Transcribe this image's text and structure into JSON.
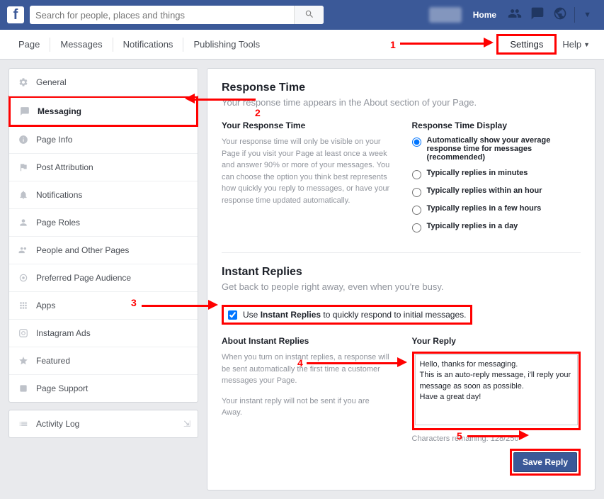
{
  "topbar": {
    "search_placeholder": "Search for people, places and things",
    "home": "Home"
  },
  "tabs": {
    "page": "Page",
    "messages": "Messages",
    "notifications": "Notifications",
    "publishing": "Publishing Tools",
    "settings": "Settings",
    "help": "Help"
  },
  "sidebar": {
    "general": "General",
    "messaging": "Messaging",
    "page_info": "Page Info",
    "post_attribution": "Post Attribution",
    "notifications": "Notifications",
    "page_roles": "Page Roles",
    "people": "People and Other Pages",
    "preferred": "Preferred Page Audience",
    "apps": "Apps",
    "instagram": "Instagram Ads",
    "featured": "Featured",
    "support": "Page Support",
    "activity": "Activity Log"
  },
  "response": {
    "title": "Response Time",
    "sub": "Your response time appears in the About section of your Page.",
    "your_title": "Your Response Time",
    "your_desc": "Your response time will only be visible on your Page if you visit your Page at least once a week and answer 90% or more of your messages. You can choose the option you think best represents how quickly you reply to messages, or have your response time updated automatically.",
    "display_title": "Response Time Display",
    "opt1": "Automatically show your average response time for messages (recommended)",
    "opt2": "Typically replies in minutes",
    "opt3": "Typically replies within an hour",
    "opt4": "Typically replies in a few hours",
    "opt5": "Typically replies in a day"
  },
  "instant": {
    "title": "Instant Replies",
    "sub": "Get back to people right away, even when you're busy.",
    "check_pre": "Use ",
    "check_bold": "Instant Replies",
    "check_post": " to quickly respond to initial messages.",
    "about_title": "About Instant Replies",
    "about_desc": "When you turn on instant replies, a response will be sent automatically the first time a customer messages your Page.",
    "about_desc2": "Your instant reply will not be sent if you are Away.",
    "reply_title": "Your Reply",
    "reply_text": "Hello, thanks for messaging.\nThis is an auto-reply message, i'll reply your message as soon as possible.\nHave a great day!",
    "chars": "Characters remaining: 128/250",
    "save": "Save Reply"
  },
  "annot": {
    "n1": "1",
    "n2": "2",
    "n3": "3",
    "n4": "4",
    "n5": "5"
  }
}
